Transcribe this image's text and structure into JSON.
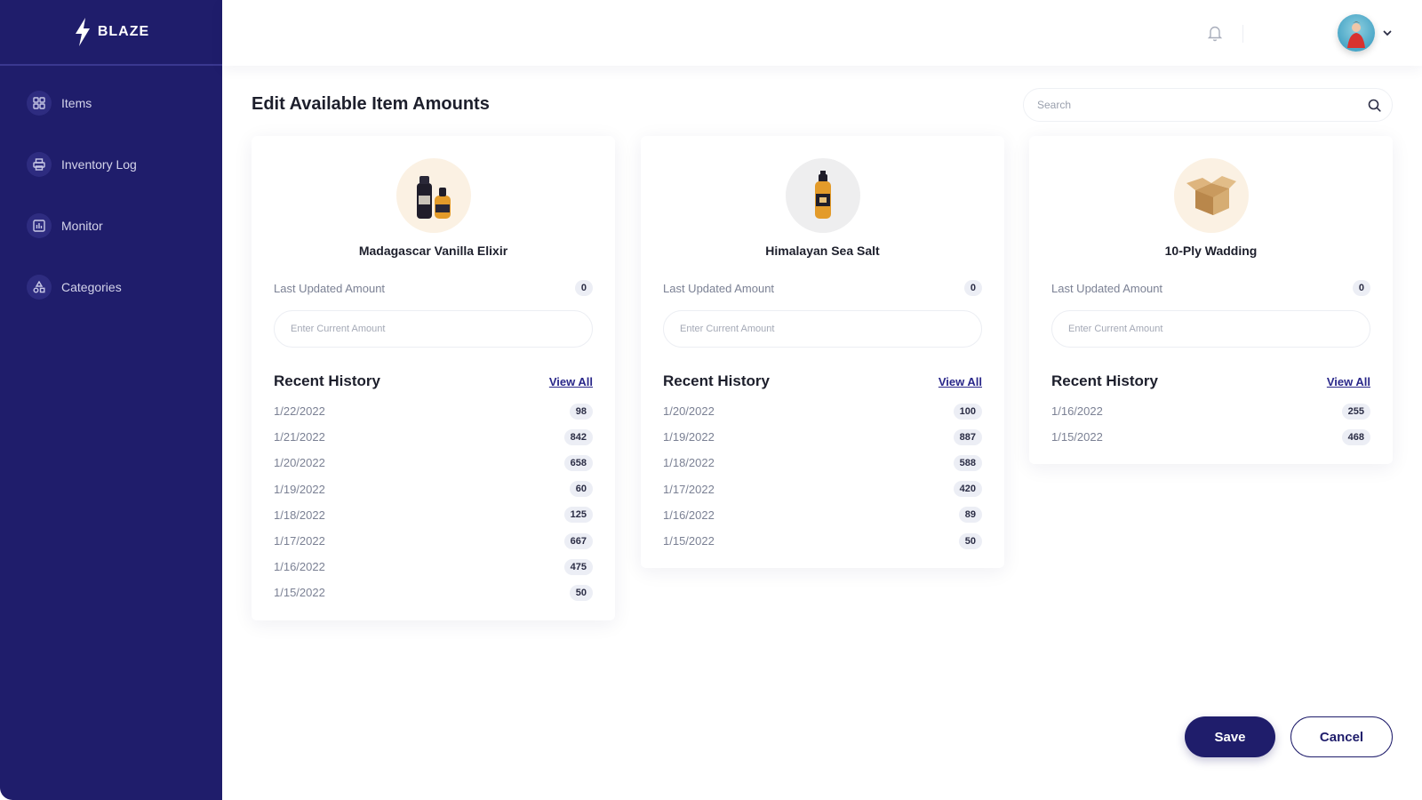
{
  "brand": {
    "name": "BLAZE",
    "icon": "lightning-bolt-icon"
  },
  "sidebar": {
    "items": [
      {
        "label": "Items",
        "icon": "grid-icon"
      },
      {
        "label": "Inventory Log",
        "icon": "printer-icon"
      },
      {
        "label": "Monitor",
        "icon": "chart-icon"
      },
      {
        "label": "Categories",
        "icon": "shapes-icon"
      }
    ]
  },
  "topbar": {
    "bell_icon": "bell-icon",
    "avatar_icon": "avatar",
    "chevron_icon": "chevron-down-icon"
  },
  "page": {
    "title": "Edit Available Item Amounts"
  },
  "search": {
    "placeholder": "Search",
    "value": ""
  },
  "cards": [
    {
      "name": "Madagascar Vanilla Elixir",
      "image": "vanilla-bottles-icon",
      "last_label": "Last Updated Amount",
      "last_value": "0",
      "input_placeholder": "Enter Current Amount",
      "history_title": "Recent History",
      "view_all": "View All",
      "history": [
        {
          "date": "1/22/2022",
          "value": "98"
        },
        {
          "date": "1/21/2022",
          "value": "842"
        },
        {
          "date": "1/20/2022",
          "value": "658"
        },
        {
          "date": "1/19/2022",
          "value": "60"
        },
        {
          "date": "1/18/2022",
          "value": "125"
        },
        {
          "date": "1/17/2022",
          "value": "667"
        },
        {
          "date": "1/16/2022",
          "value": "475"
        },
        {
          "date": "1/15/2022",
          "value": "50"
        }
      ]
    },
    {
      "name": "Himalayan Sea Salt",
      "image": "salt-bottle-icon",
      "last_label": "Last Updated Amount",
      "last_value": "0",
      "input_placeholder": "Enter Current Amount",
      "history_title": "Recent History",
      "view_all": "View All",
      "history": [
        {
          "date": "1/20/2022",
          "value": "100"
        },
        {
          "date": "1/19/2022",
          "value": "887"
        },
        {
          "date": "1/18/2022",
          "value": "588"
        },
        {
          "date": "1/17/2022",
          "value": "420"
        },
        {
          "date": "1/16/2022",
          "value": "89"
        },
        {
          "date": "1/15/2022",
          "value": "50"
        }
      ]
    },
    {
      "name": "10-Ply Wadding",
      "image": "cardboard-box-icon",
      "last_label": "Last Updated Amount",
      "last_value": "0",
      "input_placeholder": "Enter Current Amount",
      "history_title": "Recent History",
      "view_all": "View All",
      "history": [
        {
          "date": "1/16/2022",
          "value": "255"
        },
        {
          "date": "1/15/2022",
          "value": "468"
        }
      ]
    }
  ],
  "actions": {
    "save": "Save",
    "cancel": "Cancel"
  },
  "colors": {
    "primary": "#1f1d6b",
    "badge_bg": "#eceef5",
    "muted_text": "#7b8194"
  }
}
